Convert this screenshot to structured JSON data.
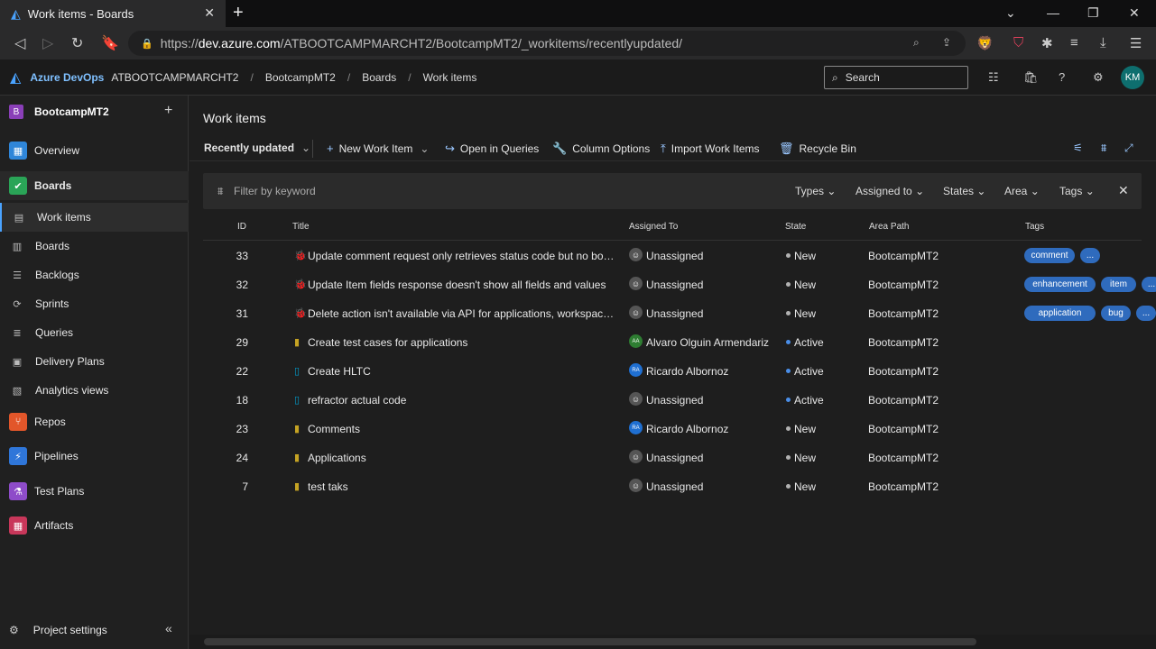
{
  "browser": {
    "tab_title": "Work items - Boards",
    "url_prefix": "https://",
    "url_host": "dev.azure.com",
    "url_path": "/ATBOOTCAMPMARCHT2/BootcampMT2/_workitems/recentlyupdated/"
  },
  "topnav": {
    "brand": "Azure DevOps",
    "breadcrumbs": [
      "ATBOOTCAMPMARCHT2",
      "BootcampMT2",
      "Boards",
      "Work items"
    ],
    "search_placeholder": "Search",
    "avatar_initials": "KM"
  },
  "sidebar": {
    "project_badge": "B",
    "project_name": "BootcampMT2",
    "items": [
      {
        "label": "Overview",
        "icon": "overview-icon",
        "color": "#2f86d9"
      },
      {
        "label": "Boards",
        "icon": "boards-icon",
        "color": "#2aa457"
      },
      {
        "label": "Work items",
        "icon": "work-items-icon"
      },
      {
        "label": "Boards",
        "icon": "board-icon"
      },
      {
        "label": "Backlogs",
        "icon": "backlogs-icon"
      },
      {
        "label": "Sprints",
        "icon": "sprints-icon"
      },
      {
        "label": "Queries",
        "icon": "queries-icon"
      },
      {
        "label": "Delivery Plans",
        "icon": "delivery-plans-icon"
      },
      {
        "label": "Analytics views",
        "icon": "analytics-icon"
      },
      {
        "label": "Repos",
        "icon": "repos-icon",
        "color": "#e2562a"
      },
      {
        "label": "Pipelines",
        "icon": "pipelines-icon",
        "color": "#2f76d9"
      },
      {
        "label": "Test Plans",
        "icon": "test-plans-icon",
        "color": "#8e4cc9"
      },
      {
        "label": "Artifacts",
        "icon": "artifacts-icon",
        "color": "#c8375a"
      }
    ],
    "settings_label": "Project settings"
  },
  "main": {
    "page_title": "Work items",
    "toolbar": {
      "view": "Recently updated",
      "new_item": "New Work Item",
      "open_queries": "Open in Queries",
      "column_options": "Column Options",
      "import": "Import Work Items",
      "recycle": "Recycle Bin"
    },
    "filter": {
      "placeholder": "Filter by keyword",
      "types": "Types",
      "assigned": "Assigned to",
      "states": "States",
      "area": "Area",
      "tags": "Tags"
    },
    "columns": {
      "id": "ID",
      "title": "Title",
      "assigned": "Assigned To",
      "state": "State",
      "area": "Area Path",
      "tags": "Tags"
    },
    "rows": [
      {
        "id": "33",
        "type": "bug",
        "title": "Update comment request only retrieves status code but no body",
        "assigned": "Unassigned",
        "avatar": "",
        "state": "New",
        "area": "BootcampMT2",
        "tags": [
          "comment",
          "..."
        ]
      },
      {
        "id": "32",
        "type": "bug",
        "title": "Update Item fields response doesn't show all fields and values",
        "assigned": "Unassigned",
        "avatar": "",
        "state": "New",
        "area": "BootcampMT2",
        "tags": [
          "enhancement",
          "item",
          "..."
        ]
      },
      {
        "id": "31",
        "type": "bug",
        "title": "Delete action isn't available via API for applications, workspaces, or...",
        "assigned": "Unassigned",
        "avatar": "",
        "state": "New",
        "area": "BootcampMT2",
        "tags": [
          "application",
          "bug",
          "..."
        ]
      },
      {
        "id": "29",
        "type": "task",
        "title": "Create test cases for applications",
        "assigned": "Alvaro Olguin Armendariz",
        "avatar": "AA",
        "state": "Active",
        "area": "BootcampMT2",
        "tags": []
      },
      {
        "id": "22",
        "type": "story",
        "title": "Create HLTC",
        "assigned": "Ricardo Albornoz",
        "avatar": "RA",
        "state": "Active",
        "area": "BootcampMT2",
        "tags": []
      },
      {
        "id": "18",
        "type": "story",
        "title": "refractor actual code",
        "assigned": "Unassigned",
        "avatar": "",
        "state": "Active",
        "area": "BootcampMT2",
        "tags": []
      },
      {
        "id": "23",
        "type": "task",
        "title": "Comments",
        "assigned": "Ricardo Albornoz",
        "avatar": "RA",
        "state": "New",
        "area": "BootcampMT2",
        "tags": []
      },
      {
        "id": "24",
        "type": "task",
        "title": "Applications",
        "assigned": "Unassigned",
        "avatar": "",
        "state": "New",
        "area": "BootcampMT2",
        "tags": []
      },
      {
        "id": "7",
        "type": "task",
        "title": "test taks",
        "assigned": "Unassigned",
        "avatar": "",
        "state": "New",
        "area": "BootcampMT2",
        "tags": []
      }
    ]
  },
  "colors": {
    "accent": "#4aa3ff",
    "tag": "#2f6bbd",
    "bug": "#cc293d",
    "task": "#c5a323",
    "story": "#009ccc",
    "state_new": "#b2b2b2",
    "state_active": "#4a8ee8"
  }
}
